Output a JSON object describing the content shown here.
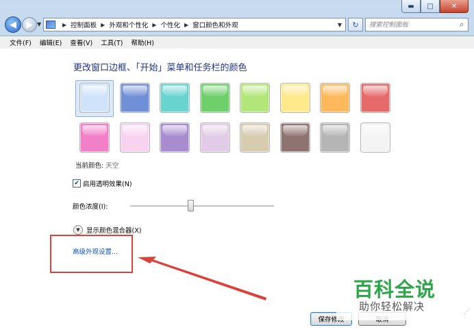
{
  "window": {
    "caption_buttons": {
      "minimize": "▬",
      "maximize": "□",
      "close": "✕"
    }
  },
  "nav": {
    "back_icon": "back-arrow-icon",
    "forward_icon": "forward-arrow-icon",
    "breadcrumb": [
      "控制面板",
      "外观和个性化",
      "个性化",
      "窗口颜色和外观"
    ],
    "search_placeholder": "搜索控制面板"
  },
  "menu": [
    "文件(F)",
    "编辑(E)",
    "查看(V)",
    "工具(T)",
    "帮助(H)"
  ],
  "page": {
    "title": "更改窗口边框、「开始」菜单和任务栏的颜色",
    "swatches": [
      {
        "name": "sky",
        "color": "#cfe3fb"
      },
      {
        "name": "twilight",
        "color": "#6f8fd6"
      },
      {
        "name": "sea",
        "color": "#69d3d0"
      },
      {
        "name": "leaf",
        "color": "#6fcf6b"
      },
      {
        "name": "lime",
        "color": "#b3e67a"
      },
      {
        "name": "sun",
        "color": "#ffe98a"
      },
      {
        "name": "pumpkin",
        "color": "#ffb95a"
      },
      {
        "name": "ruby",
        "color": "#e76a6a"
      },
      {
        "name": "fuchsia",
        "color": "#f47fc9"
      },
      {
        "name": "blush",
        "color": "#f8d3f0"
      },
      {
        "name": "violet",
        "color": "#a98ccf"
      },
      {
        "name": "lavender",
        "color": "#e2cbe6"
      },
      {
        "name": "taupe",
        "color": "#d7cbb0"
      },
      {
        "name": "chocolate",
        "color": "#8f7371"
      },
      {
        "name": "slate",
        "color": "#b5b5b5"
      },
      {
        "name": "frost",
        "color": "#f4f4f4"
      }
    ],
    "current_color_label": "当前颜色:",
    "current_color_value": "天空",
    "transparency_label": "启用透明效果(N)",
    "transparency_checked": true,
    "intensity_label": "颜色浓度(I):",
    "intensity_level_percent": 42,
    "mixer_label": "显示颜色混合器(X)",
    "advanced_link": "高级外观设置..."
  },
  "buttons": {
    "save": "保存修改",
    "cancel": "取消"
  },
  "watermark": {
    "line1": "百科全说",
    "line2": "助你轻松解决"
  },
  "colors": {
    "accent": "#1e3287",
    "link": "#0f56b8",
    "highlight": "#d9423a",
    "watermark": "#2ea64a"
  }
}
